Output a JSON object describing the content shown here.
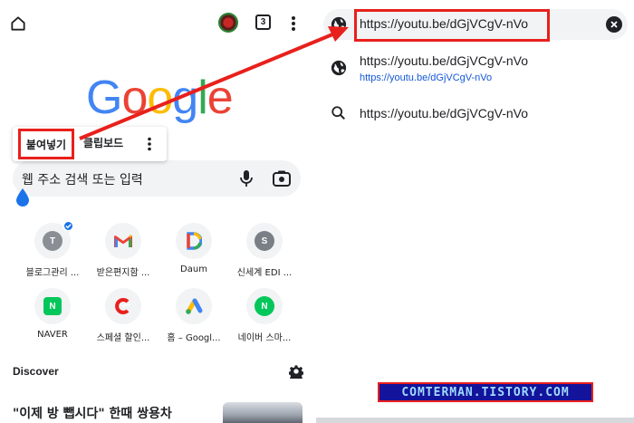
{
  "left_panel": {
    "tab_count": "3",
    "paste_popup": {
      "paste_label": "붙여넣기",
      "clipboard_label": "클립보드"
    },
    "search": {
      "placeholder": "웹 주소 검색 또는 입력"
    },
    "logo_letters": [
      {
        "char": "G",
        "color": "#4285F4"
      },
      {
        "char": "o",
        "color": "#EA4335"
      },
      {
        "char": "o",
        "color": "#FBBC05"
      },
      {
        "char": "g",
        "color": "#4285F4"
      },
      {
        "char": "l",
        "color": "#34A853"
      },
      {
        "char": "e",
        "color": "#EA4335"
      }
    ],
    "shortcuts": [
      {
        "label": "블로그관리 ...",
        "letter": "T",
        "bg": "#8a8f96",
        "icon": "tistory-icon"
      },
      {
        "label": "받은편지함 ...",
        "letter": "M",
        "bg": "",
        "icon": "gmail-icon"
      },
      {
        "label": "Daum",
        "letter": "D",
        "bg": "",
        "icon": "daum-icon"
      },
      {
        "label": "신세계 EDI ...",
        "letter": "S",
        "bg": "#7a7f86",
        "icon": "shinsegae-icon"
      },
      {
        "label": "NAVER",
        "letter": "N",
        "bg": "#03c75a",
        "icon": "naver-icon"
      },
      {
        "label": "스페셜 할인...",
        "letter": "C",
        "bg": "#e8201c",
        "icon": "coupang-icon"
      },
      {
        "label": "홈 – Googl...",
        "letter": "",
        "bg": "",
        "icon": "google-ads-icon"
      },
      {
        "label": "네이버 스마...",
        "letter": "N",
        "bg": "#03c75a",
        "icon": "naver-smartstore-icon"
      }
    ],
    "discover_label": "Discover",
    "news_title": "\"이제 방 뺍시다\" 한때 쌍용차"
  },
  "right_panel": {
    "omnibox_url": "https://youtu.be/dGjVCgV-nVo",
    "suggestions": [
      {
        "main": "https://youtu.be/dGjVCgV-nVo",
        "sub": "https://youtu.be/dGjVCgV-nVo",
        "icon": "globe-icon"
      },
      {
        "main": "https://youtu.be/dGjVCgV-nVo",
        "sub": "",
        "icon": "search-icon"
      }
    ],
    "watermark": "COMTERMAN.TISTORY.COM"
  },
  "colors": {
    "highlight_red": "#e8201c",
    "omnibox_bg": "#f1f3f4",
    "link_blue": "#1558d6"
  }
}
